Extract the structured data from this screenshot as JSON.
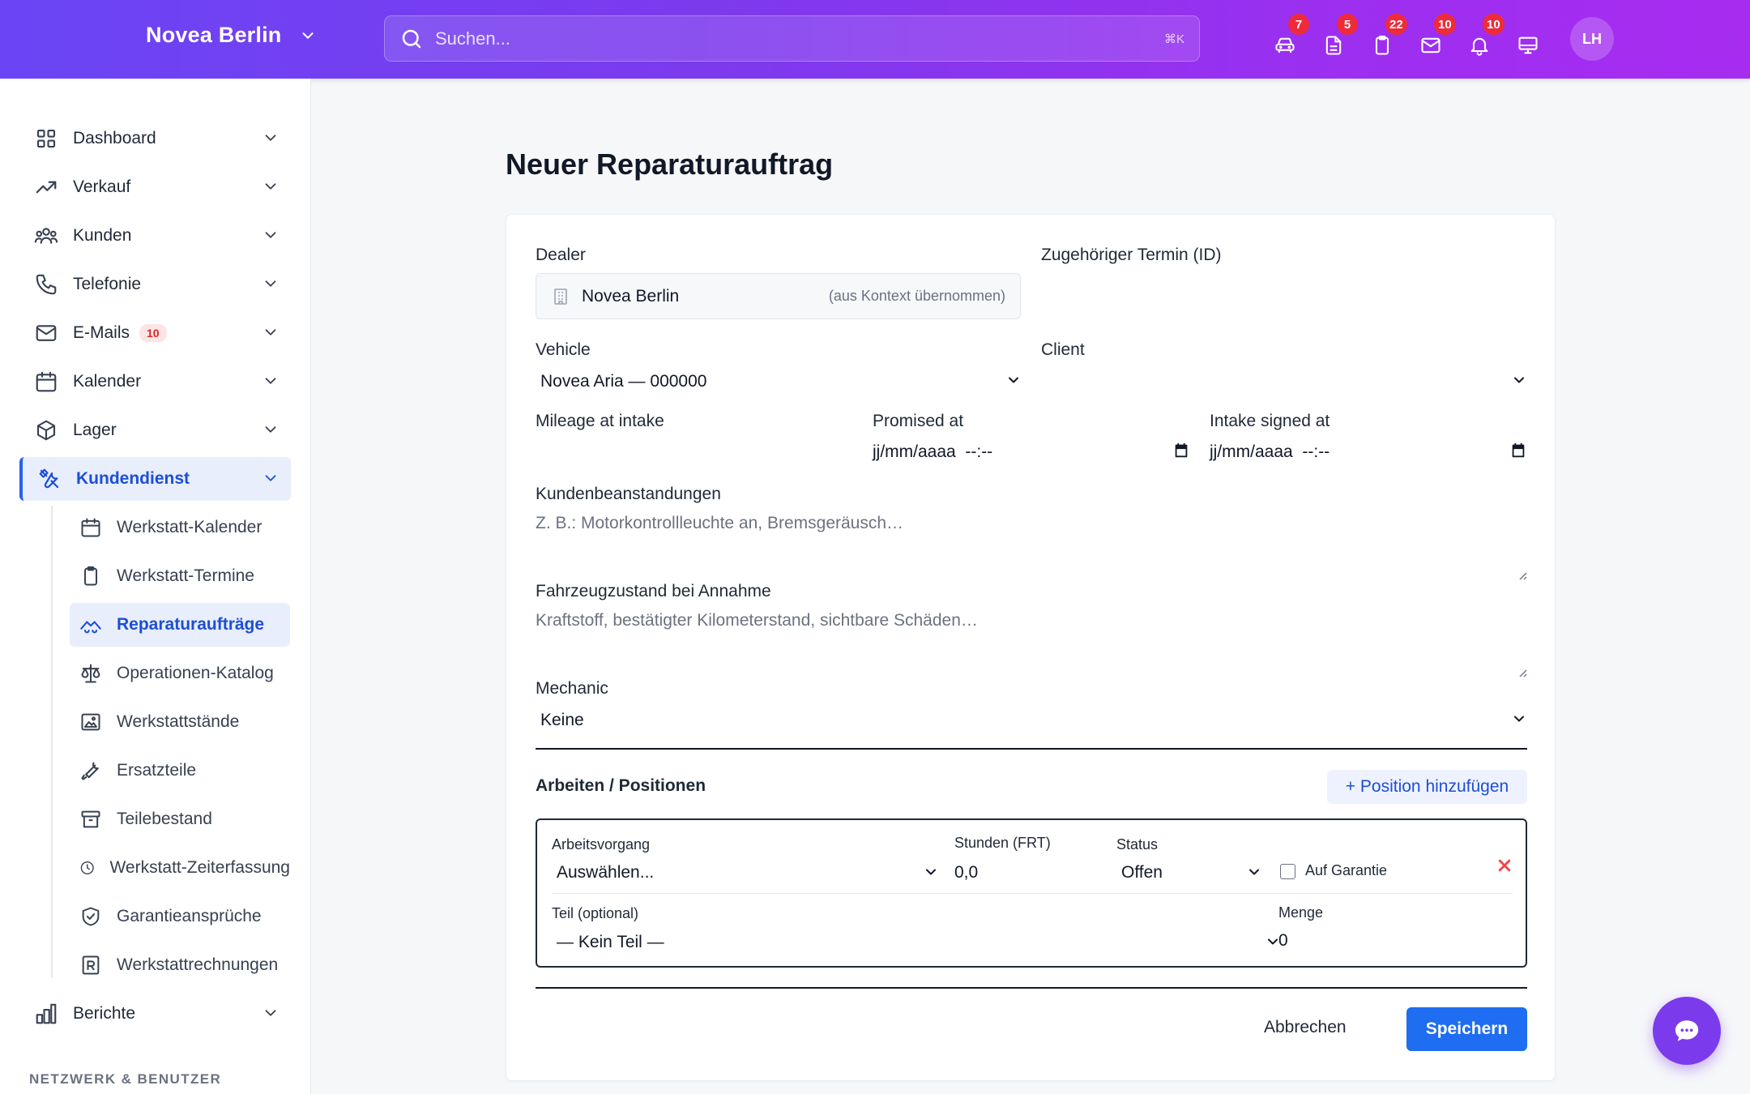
{
  "header": {
    "brand": "Novea Berlin",
    "search_placeholder": "Suchen...",
    "search_shortcut": "⌘K",
    "icons": [
      {
        "name": "vehicle-icon",
        "badge": "7"
      },
      {
        "name": "document-icon",
        "badge": "5"
      },
      {
        "name": "clipboard-icon",
        "badge": "22"
      },
      {
        "name": "mail-icon",
        "badge": "10"
      },
      {
        "name": "bell-icon",
        "badge": "10"
      },
      {
        "name": "monitor-icon",
        "badge": ""
      }
    ],
    "avatar": "LH"
  },
  "sidebar": {
    "items": [
      {
        "label": "Dashboard"
      },
      {
        "label": "Verkauf"
      },
      {
        "label": "Kunden"
      },
      {
        "label": "Telefonie"
      },
      {
        "label": "E-Mails",
        "badge": "10"
      },
      {
        "label": "Kalender"
      },
      {
        "label": "Lager"
      },
      {
        "label": "Kundendienst",
        "active": true
      },
      {
        "label": "Berichte"
      }
    ],
    "subitems": [
      {
        "label": "Werkstatt-Kalender"
      },
      {
        "label": "Werkstatt-Termine"
      },
      {
        "label": "Reparaturaufträge",
        "active": true
      },
      {
        "label": "Operationen-Katalog"
      },
      {
        "label": "Werkstattstände"
      },
      {
        "label": "Ersatzteile"
      },
      {
        "label": "Teilebestand"
      },
      {
        "label": "Werkstatt-Zeiterfassung"
      },
      {
        "label": "Garantieansprüche"
      },
      {
        "label": "Werkstattrechnungen"
      }
    ],
    "section_title": "NETZWERK & BENUTZER"
  },
  "main": {
    "title": "Neuer Reparaturauftrag",
    "form": {
      "dealer_label": "Dealer",
      "dealer_value": "Novea Berlin",
      "dealer_hint": "(aus Kontext übernommen)",
      "termin_label": "Zugehöriger Termin (ID)",
      "vehicle_label": "Vehicle",
      "vehicle_value": "Novea Aria — 000000",
      "client_label": "Client",
      "client_value": "",
      "mileage_label": "Mileage at intake",
      "promised_label": "Promised at",
      "promised_value": "jj/mm/aaaa  --:--",
      "intake_label": "Intake signed at",
      "intake_value": "jj/mm/aaaa  --:--",
      "complaints_label": "Kundenbeanstandungen",
      "complaints_placeholder": "Z. B.: Motorkontrollleuchte an, Bremsgeräusch…",
      "condition_label": "Fahrzeugzustand bei Annahme",
      "condition_placeholder": "Kraftstoff, bestätigter Kilometerstand, sichtbare Schäden…",
      "mechanic_label": "Mechanic",
      "mechanic_value": "Keine"
    },
    "positions": {
      "title": "Arbeiten / Positionen",
      "add_label": "+ Position hinzufügen",
      "row": {
        "operation_label": "Arbeitsvorgang",
        "operation_value": "Auswählen...",
        "hours_label": "Stunden (FRT)",
        "hours_value": "0,0",
        "status_label": "Status",
        "status_value": "Offen",
        "warranty_label": "Auf Garantie",
        "warranty_checked": false,
        "part_label": "Teil (optional)",
        "part_value": "— Kein Teil —",
        "qty_label": "Menge",
        "qty_value": "0"
      }
    },
    "actions": {
      "cancel": "Abbrechen",
      "save": "Speichern"
    }
  },
  "colors": {
    "header_gradient_start": "#6a45f5",
    "header_gradient_end": "#a72cf0",
    "accent": "#1f6df0",
    "active_text": "#1d4ed8",
    "badge_red": "#ef2b3a",
    "chat_button": "#7c3aed"
  }
}
